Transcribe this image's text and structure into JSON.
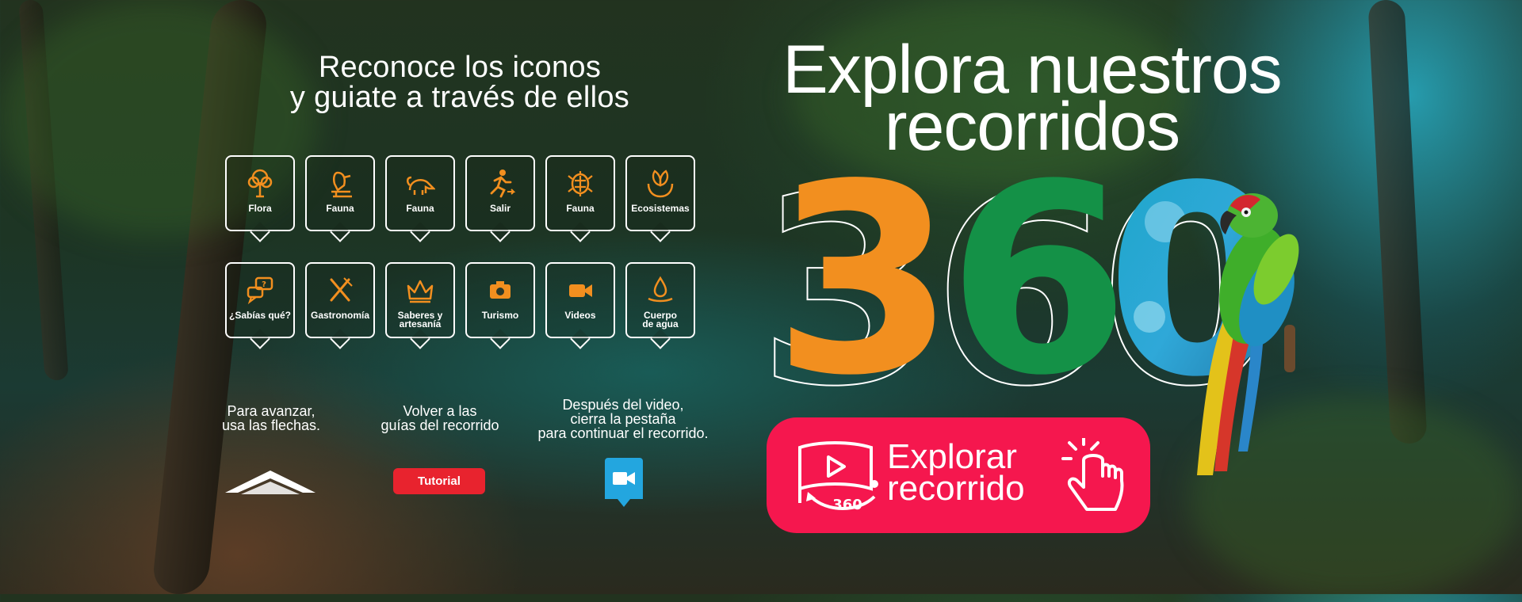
{
  "subtitle": {
    "line1": "Reconoce los iconos",
    "line2": "y guiate a través de ellos"
  },
  "icons": [
    {
      "label": "Flora",
      "icon": "tree-icon"
    },
    {
      "label": "Fauna",
      "icon": "bird-icon"
    },
    {
      "label": "Fauna",
      "icon": "anteater-icon"
    },
    {
      "label": "Salir",
      "icon": "running-person-icon"
    },
    {
      "label": "Fauna",
      "icon": "turtle-icon"
    },
    {
      "label": "Ecosistemas",
      "icon": "leaves-hand-icon"
    },
    {
      "label": "¿Sabías qué?",
      "icon": "speech-bubbles-icon"
    },
    {
      "label": "Gastronomía",
      "icon": "fork-knife-icon"
    },
    {
      "label": "Saberes y\nartesanía",
      "icon": "crown-craft-icon"
    },
    {
      "label": "Turismo",
      "icon": "camera-icon"
    },
    {
      "label": "Videos",
      "icon": "video-camera-icon"
    },
    {
      "label": "Cuerpo\nde agua",
      "icon": "water-drop-icon"
    }
  ],
  "instructions": {
    "advance": "Para avanzar,\nusa las flechas.",
    "back": "Volver a las\nguías del recorrido",
    "video": "Después del video,\ncierra la pestaña\npara continuar el recorrido."
  },
  "tutorial_label": "Tutorial",
  "title": {
    "line1": "Explora nuestros",
    "line2": "recorridos"
  },
  "big_number": {
    "d1": "3",
    "d2": "6",
    "d3": "0"
  },
  "cta": {
    "line1": "Explorar",
    "line2": "recorrido",
    "badge": "360"
  },
  "colors": {
    "orange": "#f28f1f",
    "green": "#149147",
    "cta": "#f5174e",
    "tutorial": "#e8232e",
    "video_badge": "#23a6df"
  }
}
